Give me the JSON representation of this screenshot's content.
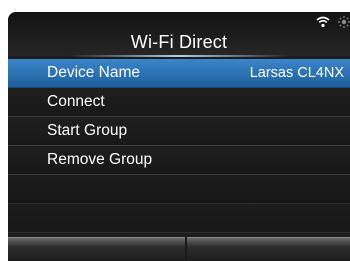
{
  "header": {
    "title": "Wi-Fi Direct",
    "status_icons": [
      "wifi-icon",
      "sun-icon"
    ]
  },
  "menu": {
    "items": [
      {
        "label": "Device Name",
        "value": "Larsas CL4NX",
        "selected": true
      },
      {
        "label": "Connect",
        "value": "",
        "selected": false
      },
      {
        "label": "Start Group",
        "value": "",
        "selected": false
      },
      {
        "label": "Remove Group",
        "value": "",
        "selected": false
      }
    ]
  },
  "softkeys": {
    "left_label": "",
    "right_label": ""
  },
  "colors": {
    "selected_row": "#2f78bd",
    "background": "#1c1c1c",
    "text": "#ffffff"
  }
}
